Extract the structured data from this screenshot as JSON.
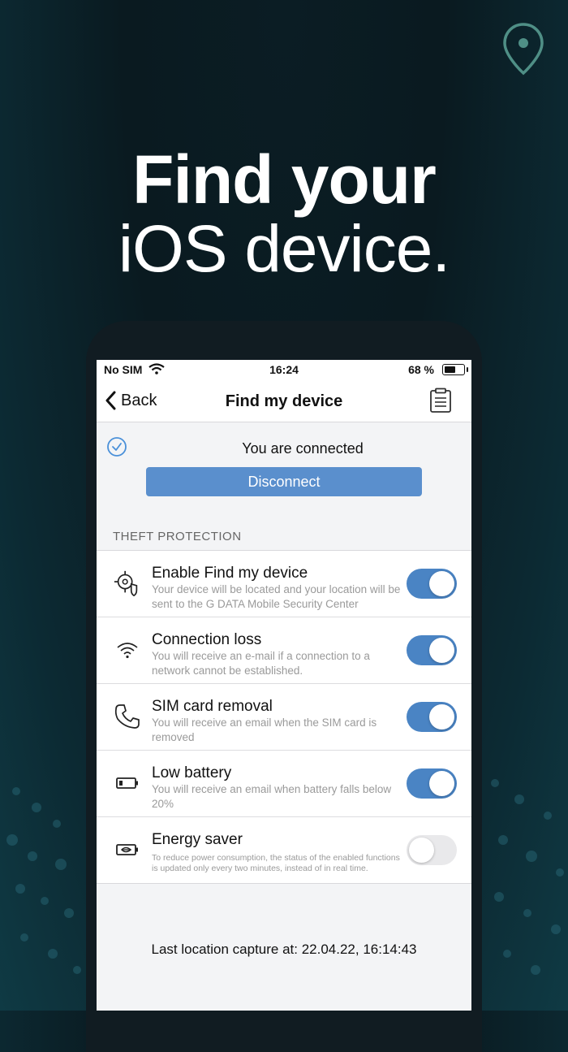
{
  "promo": {
    "headline_bold": "Find your",
    "headline_light": "iOS device."
  },
  "status_bar": {
    "carrier": "No SIM",
    "time": "16:24",
    "battery_text": "68 %",
    "battery_level": 0.68
  },
  "nav": {
    "back_label": "Back",
    "title": "Find my device"
  },
  "connection": {
    "status_text": "You are connected",
    "disconnect_label": "Disconnect"
  },
  "section": {
    "header": "THEFT PROTECTION"
  },
  "settings": [
    {
      "icon": "locate-shield-icon",
      "title": "Enable Find my device",
      "subtitle": "Your device will be located and your location will be sent to the G DATA Mobile Security Center",
      "enabled": true
    },
    {
      "icon": "wifi-icon",
      "title": "Connection loss",
      "subtitle": "You will receive an e-mail if a connection to a network cannot be established.",
      "enabled": true
    },
    {
      "icon": "phone-icon",
      "title": "SIM card removal",
      "subtitle": "You will receive an email when the SIM card is removed",
      "enabled": true
    },
    {
      "icon": "battery-low-icon",
      "title": "Low battery",
      "subtitle": "You will receive an email when battery falls below 20%",
      "enabled": true
    },
    {
      "icon": "energy-saver-icon",
      "title": "Energy saver",
      "subtitle": "To reduce power consumption, the status of the enabled functions is updated only every two minutes, instead of in real time.",
      "enabled": false
    }
  ],
  "footer": {
    "last_capture": "Last location capture at: 22.04.22, 16:14:43"
  },
  "colors": {
    "accent": "#4a84c4",
    "button": "#5a8fcd",
    "pin": "#4f8f86"
  }
}
